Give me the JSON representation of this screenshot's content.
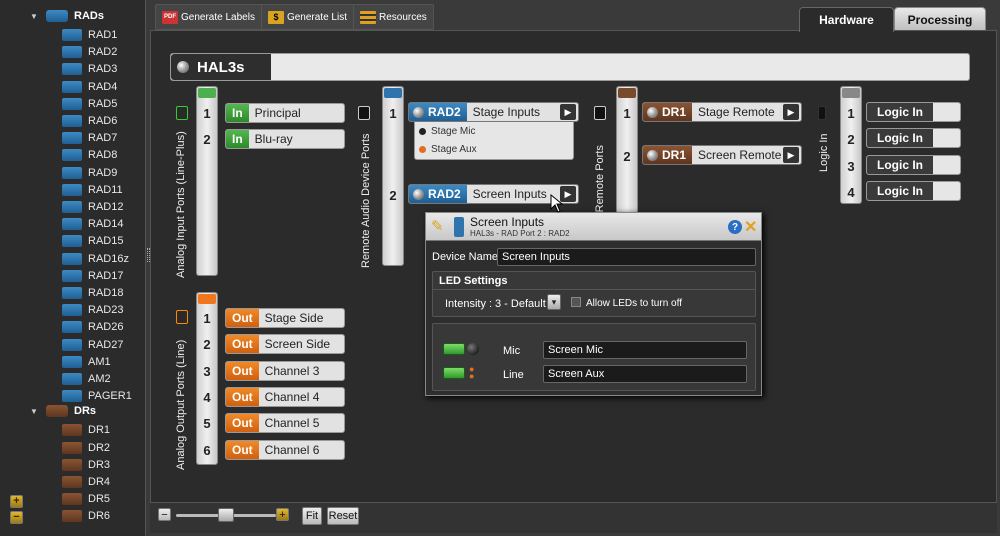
{
  "sidebar": {
    "groups": [
      {
        "label": "RADs",
        "items": [
          "RAD1",
          "RAD2",
          "RAD3",
          "RAD4",
          "RAD5",
          "RAD6",
          "RAD7",
          "RAD8",
          "RAD9",
          "RAD11",
          "RAD12",
          "RAD14",
          "RAD15",
          "RAD16z",
          "RAD17",
          "RAD18",
          "RAD23",
          "RAD26",
          "RAD27",
          "AM1",
          "AM2",
          "PAGER1"
        ]
      },
      {
        "label": "DRs",
        "items": [
          "DR1",
          "DR2",
          "DR3",
          "DR4",
          "DR5",
          "DR6"
        ]
      }
    ]
  },
  "toolbar": {
    "generate_labels": "Generate Labels",
    "generate_labels_icon": "PDF",
    "generate_list": "Generate List",
    "generate_list_icon": "$",
    "resources": "Resources"
  },
  "tabs": {
    "hardware": "Hardware",
    "processing": "Processing"
  },
  "device": {
    "title": "HAL3s"
  },
  "analog_input": {
    "label": "Analog Input Ports (Line-Plus)",
    "tag": "In",
    "ports": [
      {
        "num": "1",
        "name": "Principal"
      },
      {
        "num": "2",
        "name": "Blu-ray"
      }
    ]
  },
  "analog_output": {
    "label": "Analog Output Ports (Line)",
    "tag": "Out",
    "ports": [
      {
        "num": "1",
        "name": "Stage Side"
      },
      {
        "num": "2",
        "name": "Screen Side"
      },
      {
        "num": "3",
        "name": "Channel 3"
      },
      {
        "num": "4",
        "name": "Channel 4"
      },
      {
        "num": "5",
        "name": "Channel 5"
      },
      {
        "num": "6",
        "name": "Channel 6"
      }
    ]
  },
  "remote_audio": {
    "label": "Remote Audio Device Ports",
    "ports": [
      {
        "num": "1",
        "device": "RAD2",
        "name": "Stage Inputs",
        "items": [
          "Stage Mic",
          "Stage Aux"
        ]
      },
      {
        "num": "2",
        "device": "RAD2",
        "name": "Screen Inputs"
      }
    ]
  },
  "digital_remote": {
    "label": "Digital Remote Ports",
    "ports": [
      {
        "num": "1",
        "device": "DR1",
        "name": "Stage Remote"
      },
      {
        "num": "2",
        "device": "DR1",
        "name": "Screen Remote"
      }
    ]
  },
  "logic_in": {
    "label": "Logic In",
    "tag": "Logic In",
    "ports": [
      "1",
      "2",
      "3",
      "4"
    ]
  },
  "popup": {
    "title": "Screen Inputs",
    "subtitle": "HAL3s - RAD Port 2  :  RAD2",
    "device_name_label": "Device Name:",
    "device_name_value": "Screen Inputs",
    "led_settings_label": "LED Settings",
    "intensity_label": "Intensity :",
    "intensity_value": "3 - Default",
    "allow_leds_label": "Allow LEDs to turn off",
    "mic_label": "Mic",
    "mic_value": "Screen Mic",
    "line_label": "Line",
    "line_value": "Screen Aux"
  },
  "bottom": {
    "fit": "Fit",
    "reset": "Reset",
    "zoom_level": 0.5
  },
  "colors": {
    "rad_blue": "#2f74ad",
    "dr_brown": "#7a4a2c",
    "in_green": "#3da13a",
    "out_orange": "#e8751a"
  }
}
